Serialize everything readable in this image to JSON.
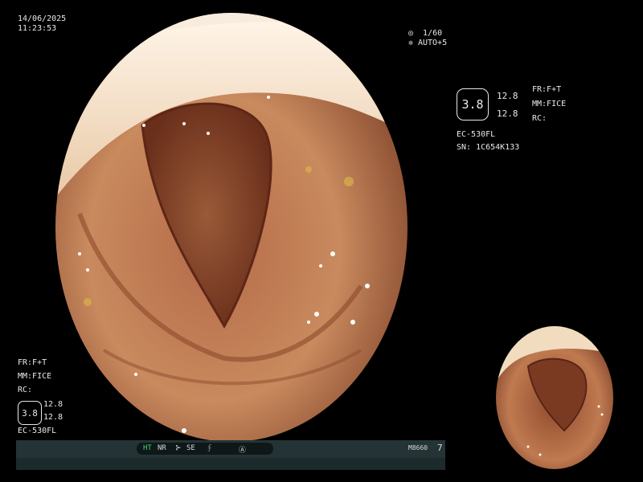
{
  "header": {
    "date": "14/06/2025",
    "time": "11:23:53"
  },
  "shutter": {
    "speed": "1/60",
    "auto": "AUTO+5",
    "speed_icon": "shutter-icon",
    "auto_icon": "iris-icon"
  },
  "info_right": {
    "hex_value": "3.8",
    "value_top": "12.8",
    "value_bottom": "12.8",
    "fr": "FR:F+T",
    "mm": "MM:FICE",
    "rc": "RC:",
    "model": "EC-530FL",
    "serial": "SN: 1C654K133"
  },
  "info_left": {
    "fr": "FR:F+T",
    "mm": "MM:FICE",
    "rc": "RC:",
    "hex_value": "3.8",
    "value_top": "12.8",
    "value_bottom": "12.8",
    "model": "EC-530FL"
  },
  "bottom_bar": {
    "ht": "HT",
    "nr": "NR",
    "se": "SE",
    "code": "M8660",
    "number": "7",
    "ht_color": "#3fd46a"
  }
}
